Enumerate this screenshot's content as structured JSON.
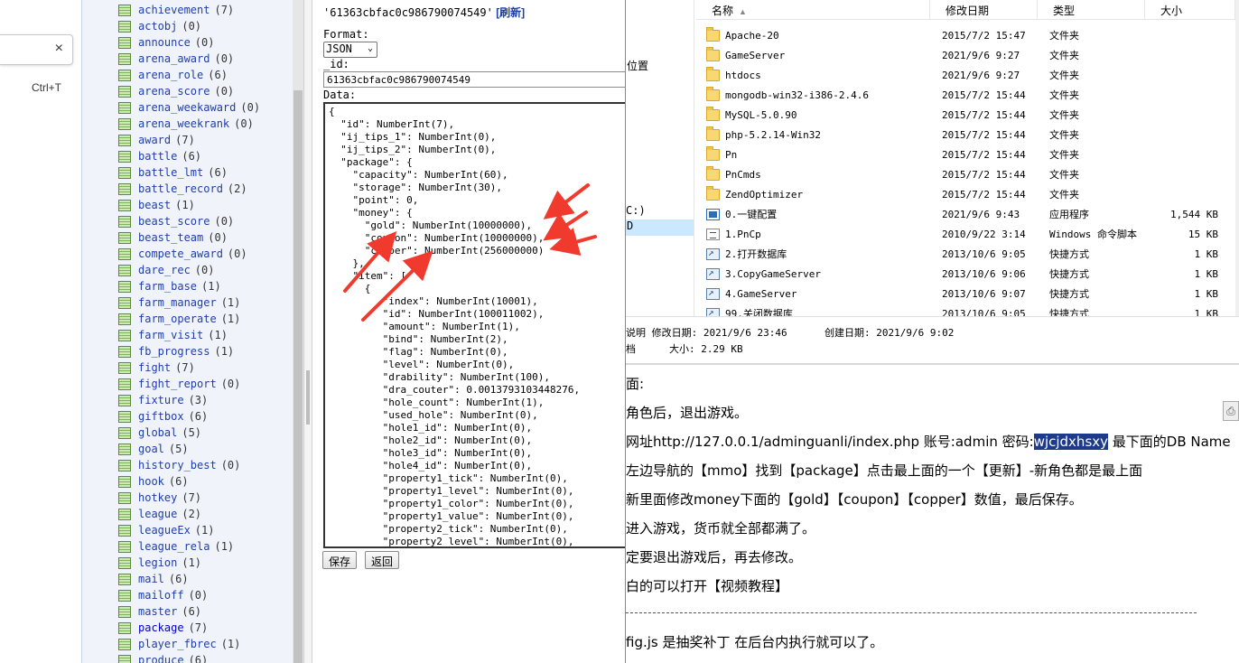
{
  "findbar": {
    "close": "×",
    "shortcut": "Ctrl+T"
  },
  "collections": [
    {
      "name": "achievement",
      "count": "(7)"
    },
    {
      "name": "actobj",
      "count": "(0)"
    },
    {
      "name": "announce",
      "count": "(0)"
    },
    {
      "name": "arena_award",
      "count": "(0)"
    },
    {
      "name": "arena_role",
      "count": "(6)"
    },
    {
      "name": "arena_score",
      "count": "(0)"
    },
    {
      "name": "arena_weekaward",
      "count": "(0)"
    },
    {
      "name": "arena_weekrank",
      "count": "(0)"
    },
    {
      "name": "award",
      "count": "(7)"
    },
    {
      "name": "battle",
      "count": "(6)"
    },
    {
      "name": "battle_lmt",
      "count": "(6)"
    },
    {
      "name": "battle_record",
      "count": "(2)"
    },
    {
      "name": "beast",
      "count": "(1)"
    },
    {
      "name": "beast_score",
      "count": "(0)"
    },
    {
      "name": "beast_team",
      "count": "(0)"
    },
    {
      "name": "compete_award",
      "count": "(0)"
    },
    {
      "name": "dare_rec",
      "count": "(0)"
    },
    {
      "name": "farm_base",
      "count": "(1)"
    },
    {
      "name": "farm_manager",
      "count": "(1)"
    },
    {
      "name": "farm_operate",
      "count": "(1)"
    },
    {
      "name": "farm_visit",
      "count": "(1)"
    },
    {
      "name": "fb_progress",
      "count": "(1)"
    },
    {
      "name": "fight",
      "count": "(7)"
    },
    {
      "name": "fight_report",
      "count": "(0)"
    },
    {
      "name": "fixture",
      "count": "(3)"
    },
    {
      "name": "giftbox",
      "count": "(6)"
    },
    {
      "name": "global",
      "count": "(5)"
    },
    {
      "name": "goal",
      "count": "(5)"
    },
    {
      "name": "history_best",
      "count": "(0)"
    },
    {
      "name": "hook",
      "count": "(6)"
    },
    {
      "name": "hotkey",
      "count": "(7)"
    },
    {
      "name": "league",
      "count": "(2)"
    },
    {
      "name": "leagueEx",
      "count": "(1)"
    },
    {
      "name": "league_rela",
      "count": "(1)"
    },
    {
      "name": "legion",
      "count": "(1)"
    },
    {
      "name": "mail",
      "count": "(6)"
    },
    {
      "name": "mailoff",
      "count": "(0)"
    },
    {
      "name": "master",
      "count": "(6)"
    },
    {
      "name": "package",
      "count": "(7)",
      "active": true
    },
    {
      "name": "player_fbrec",
      "count": "(1)"
    },
    {
      "name": "produce",
      "count": "(6)"
    }
  ],
  "editor": {
    "doc_id_quoted": "'61363cbfac0c986790074549'",
    "refresh": "[刷新]",
    "format_label": "Format:",
    "format_value": "JSON",
    "id_label": "_id:",
    "id_value": "61363cbfac0c986790074549",
    "data_label": "Data:",
    "code_lines": [
      "{",
      "  \"id\": NumberInt(7),",
      "  \"ij_tips_1\": NumberInt(0),",
      "  \"ij_tips_2\": NumberInt(0),",
      "  \"package\": {",
      "    \"capacity\": NumberInt(60),",
      "    \"storage\": NumberInt(30),",
      "    \"point\": 0,",
      "    \"money\": {",
      "      \"gold\": NumberInt(10000000),",
      "      \"coupon\": NumberInt(10000000),",
      "      \"copper\": NumberInt(256000000)",
      "    },",
      "    \"item\": [",
      "      {",
      "         \"index\": NumberInt(10001),",
      "         \"id\": NumberInt(100011002),",
      "         \"amount\": NumberInt(1),",
      "         \"bind\": NumberInt(2),",
      "         \"flag\": NumberInt(0),",
      "         \"level\": NumberInt(0),",
      "         \"drability\": NumberInt(100),",
      "         \"dra_couter\": 0.0013793103448276,",
      "         \"hole_count\": NumberInt(1),",
      "         \"used_hole\": NumberInt(0),",
      "         \"hole1_id\": NumberInt(0),",
      "         \"hole2_id\": NumberInt(0),",
      "         \"hole3_id\": NumberInt(0),",
      "         \"hole4_id\": NumberInt(0),",
      "         \"property1_tick\": NumberInt(0),",
      "         \"property1_level\": NumberInt(0),",
      "         \"property1_color\": NumberInt(0),",
      "         \"property1_value\": NumberInt(0),",
      "         \"property2_tick\": NumberInt(0),",
      "         \"property2_level\": NumberInt(0),"
    ],
    "save_label": "保存",
    "back_label": "返回"
  },
  "explorer": {
    "nav_location": "位置",
    "nav_drive": "C:)",
    "nav_selected": "D",
    "headers": {
      "name": "名称",
      "date": "修改日期",
      "type": "类型",
      "size": "大小"
    },
    "files": [
      {
        "icon": "folder",
        "name": "Apache-20",
        "date": "2015/7/2 15:47",
        "type": "文件夹",
        "size": ""
      },
      {
        "icon": "folder",
        "name": "GameServer",
        "date": "2021/9/6 9:27",
        "type": "文件夹",
        "size": ""
      },
      {
        "icon": "folder",
        "name": "htdocs",
        "date": "2021/9/6 9:27",
        "type": "文件夹",
        "size": ""
      },
      {
        "icon": "folder",
        "name": "mongodb-win32-i386-2.4.6",
        "date": "2015/7/2 15:44",
        "type": "文件夹",
        "size": ""
      },
      {
        "icon": "folder",
        "name": "MySQL-5.0.90",
        "date": "2015/7/2 15:44",
        "type": "文件夹",
        "size": ""
      },
      {
        "icon": "folder",
        "name": "php-5.2.14-Win32",
        "date": "2015/7/2 15:44",
        "type": "文件夹",
        "size": ""
      },
      {
        "icon": "folder",
        "name": "Pn",
        "date": "2015/7/2 15:44",
        "type": "文件夹",
        "size": ""
      },
      {
        "icon": "folder",
        "name": "PnCmds",
        "date": "2015/7/2 15:44",
        "type": "文件夹",
        "size": ""
      },
      {
        "icon": "folder",
        "name": "ZendOptimizer",
        "date": "2015/7/2 15:44",
        "type": "文件夹",
        "size": ""
      },
      {
        "icon": "app",
        "name": "0.一键配置",
        "date": "2021/9/6 9:43",
        "type": "应用程序",
        "size": "1,544 KB"
      },
      {
        "icon": "script",
        "name": "1.PnCp",
        "date": "2010/9/22 3:14",
        "type": "Windows 命令脚本",
        "size": "15 KB"
      },
      {
        "icon": "shortcut",
        "name": "2.打开数据库",
        "date": "2013/10/6 9:05",
        "type": "快捷方式",
        "size": "1 KB"
      },
      {
        "icon": "shortcut",
        "name": "3.CopyGameServer",
        "date": "2013/10/6 9:06",
        "type": "快捷方式",
        "size": "1 KB"
      },
      {
        "icon": "shortcut",
        "name": "4.GameServer",
        "date": "2013/10/6 9:07",
        "type": "快捷方式",
        "size": "1 KB"
      },
      {
        "icon": "shortcut",
        "name": "99.关闭数据库",
        "date": "2013/10/6 9:05",
        "type": "快捷方式",
        "size": "1 KB"
      }
    ],
    "details": {
      "line1_prefix": "说明",
      "modified": "修改日期: 2021/9/6 23:46",
      "created": "创建日期: 2021/9/6 9:02",
      "line2_prefix": "档",
      "size": "大小: 2.29 KB"
    }
  },
  "notes": {
    "line0": "面:",
    "line1": "角色后，退出游戏。",
    "line2_a": "网址http://127.0.0.1/adminguanli/index.php  账号:admin 密码:",
    "line2_pw": "wjcjdxhsxy",
    "line2_b": " 最下面的DB Name",
    "line3": "左边导航的【mmo】找到【package】点击最上面的一个【更新】-新角色都是最上面",
    "line4": "新里面修改money下面的【gold】【coupon】【copper】数值，最后保存。",
    "line5": "进入游戏，货币就全部都满了。",
    "line6": "定要退出游戏后，再去修改。",
    "line7": "白的可以打开【视频教程】",
    "line8": "fig.js 是抽奖补丁 在后台内执行就可以了。"
  },
  "colors": {
    "link": "#1f3ea8",
    "arrow": "#f03a2e",
    "highlight": "#1e3a8a"
  }
}
